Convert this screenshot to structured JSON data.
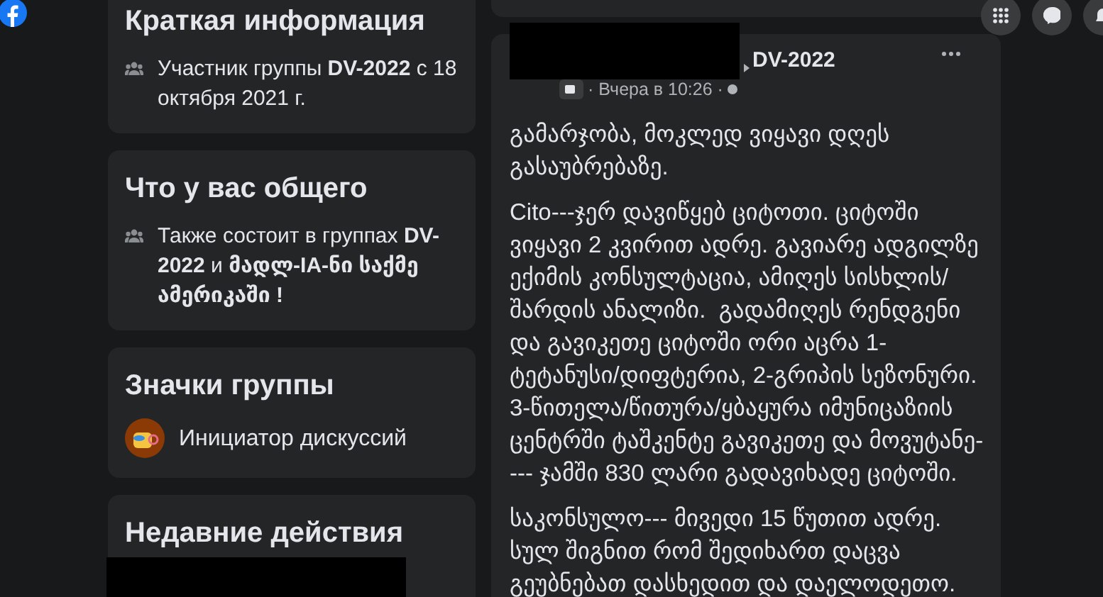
{
  "sidebar": {
    "cards": [
      {
        "title": "Краткая информация",
        "items": [
          {
            "kind": "group",
            "text": "Участник группы **DV-2022** с 18 октября 2021 г."
          }
        ]
      },
      {
        "title": "Что у вас общего",
        "items": [
          {
            "kind": "group",
            "text": "Также состоит в группах **DV-2022** и **მადლ-IA-ნი საქმე ამერიკაში !**"
          }
        ]
      },
      {
        "title": "Значки группы",
        "items": [
          {
            "kind": "badge",
            "text": "Инициатор дискуссий"
          }
        ]
      },
      {
        "title": "Недавние действия",
        "items": [
          {
            "kind": "redacted"
          }
        ]
      }
    ]
  },
  "post": {
    "group": "DV-2022",
    "time": "· Вчера в 10:26 ·",
    "paragraphs": [
      "გამარჯობა, მოკლედ ვიყავი დღეს გასაუბრებაზე.",
      "Cito---ჯერ დავიწყებ ციტოთი. ციტოში ვიყავი 2 კვირით ადრე. გავიარე ადგილზე ექიმის კონსულტაცია, ამიღეს სისხლის/შარდის ანალიზი.  გადამიღეს რენდგენი და გავიკეთე ციტოში ორი აცრა 1-ტეტანუსი/დიფტერია, 2-გრიპის სეზონური. 3-წითელა/წითურა/ყბაყურა იმუნიცაზიის ცენტრში ტაშკენტე გავიკეთე და მოვუტანე---- ჯამში 830 ლარი გადავიხადე ციტოში.",
      "საკონსულო--- მივედი 15 წუთით ადრე. სულ შიგნით რომ შედიხართ დაცვა გეუბნებათ დასხედით და დაელოდეთო."
    ]
  }
}
